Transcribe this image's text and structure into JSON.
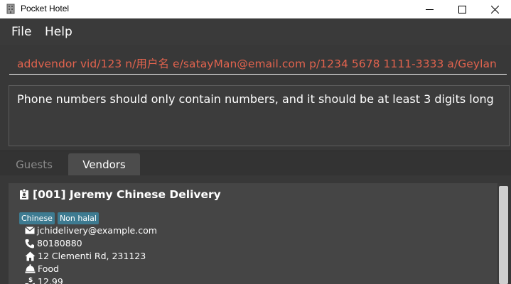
{
  "window": {
    "title": "Pocket Hotel",
    "icon": "hotel-icon"
  },
  "menu": {
    "file": "File",
    "help": "Help"
  },
  "command": {
    "value": "addvendor vid/123 n/用户名 e/satayMan@email.com p/1234 5678 1111-3333 a/Geylan"
  },
  "result": {
    "message": "Phone numbers should only contain numbers, and it should be at least 3 digits long"
  },
  "tabs": {
    "guests": "Guests",
    "vendors": "Vendors",
    "active": "Vendors"
  },
  "vendor": {
    "title": "[001] Jeremy Chinese Delivery",
    "tags": [
      "Chinese",
      "Non halal"
    ],
    "email": "jchidelivery@example.com",
    "phone": "80180880",
    "address": "12 Clementi Rd, 231123",
    "service": "Food",
    "cost": "12.99"
  },
  "colors": {
    "command_text": "#e2634e",
    "tag_bg": "#3e7b91",
    "background": "#383838"
  }
}
